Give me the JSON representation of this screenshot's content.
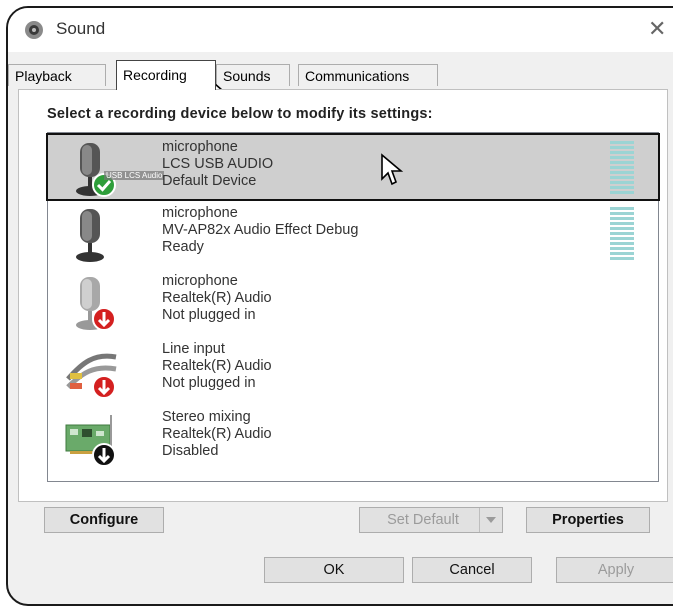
{
  "window": {
    "title": "Sound"
  },
  "tabs": [
    {
      "label": "Playback",
      "active": false
    },
    {
      "label": "Recording",
      "active": true
    },
    {
      "label": "Sounds",
      "active": false
    },
    {
      "label": "Communications",
      "active": false
    }
  ],
  "instruction": "Select a recording device below to modify its settings:",
  "devices": [
    {
      "name": "microphone",
      "driver": "LCS USB AUDIO",
      "status": "Default Device",
      "icon": "microphone-default-icon",
      "overlay_label": "USB LCS Audio",
      "selected": true
    },
    {
      "name": "microphone",
      "driver": "MV-AP82x Audio Effect Debug",
      "status": "Ready",
      "icon": "microphone-icon",
      "selected": false
    },
    {
      "name": "microphone",
      "driver": "Realtek(R) Audio",
      "status": "Not plugged in",
      "icon": "microphone-unplugged-icon",
      "selected": false
    },
    {
      "name": "Line input",
      "driver": "Realtek(R) Audio",
      "status": "Not plugged in",
      "icon": "line-input-unplugged-icon",
      "selected": false
    },
    {
      "name": "Stereo mixing",
      "driver": "Realtek(R) Audio",
      "status": "Disabled",
      "icon": "sound-card-disabled-icon",
      "selected": false
    }
  ],
  "buttons": {
    "configure": "Configure",
    "set_default": "Set Default",
    "properties": "Properties",
    "ok": "OK",
    "cancel": "Cancel",
    "apply": "Apply"
  },
  "colors": {
    "selected_row": "#cfcfcf",
    "level_meter": "#9bd4d4",
    "status_default": "#2e9e3a",
    "status_error": "#d42020"
  }
}
